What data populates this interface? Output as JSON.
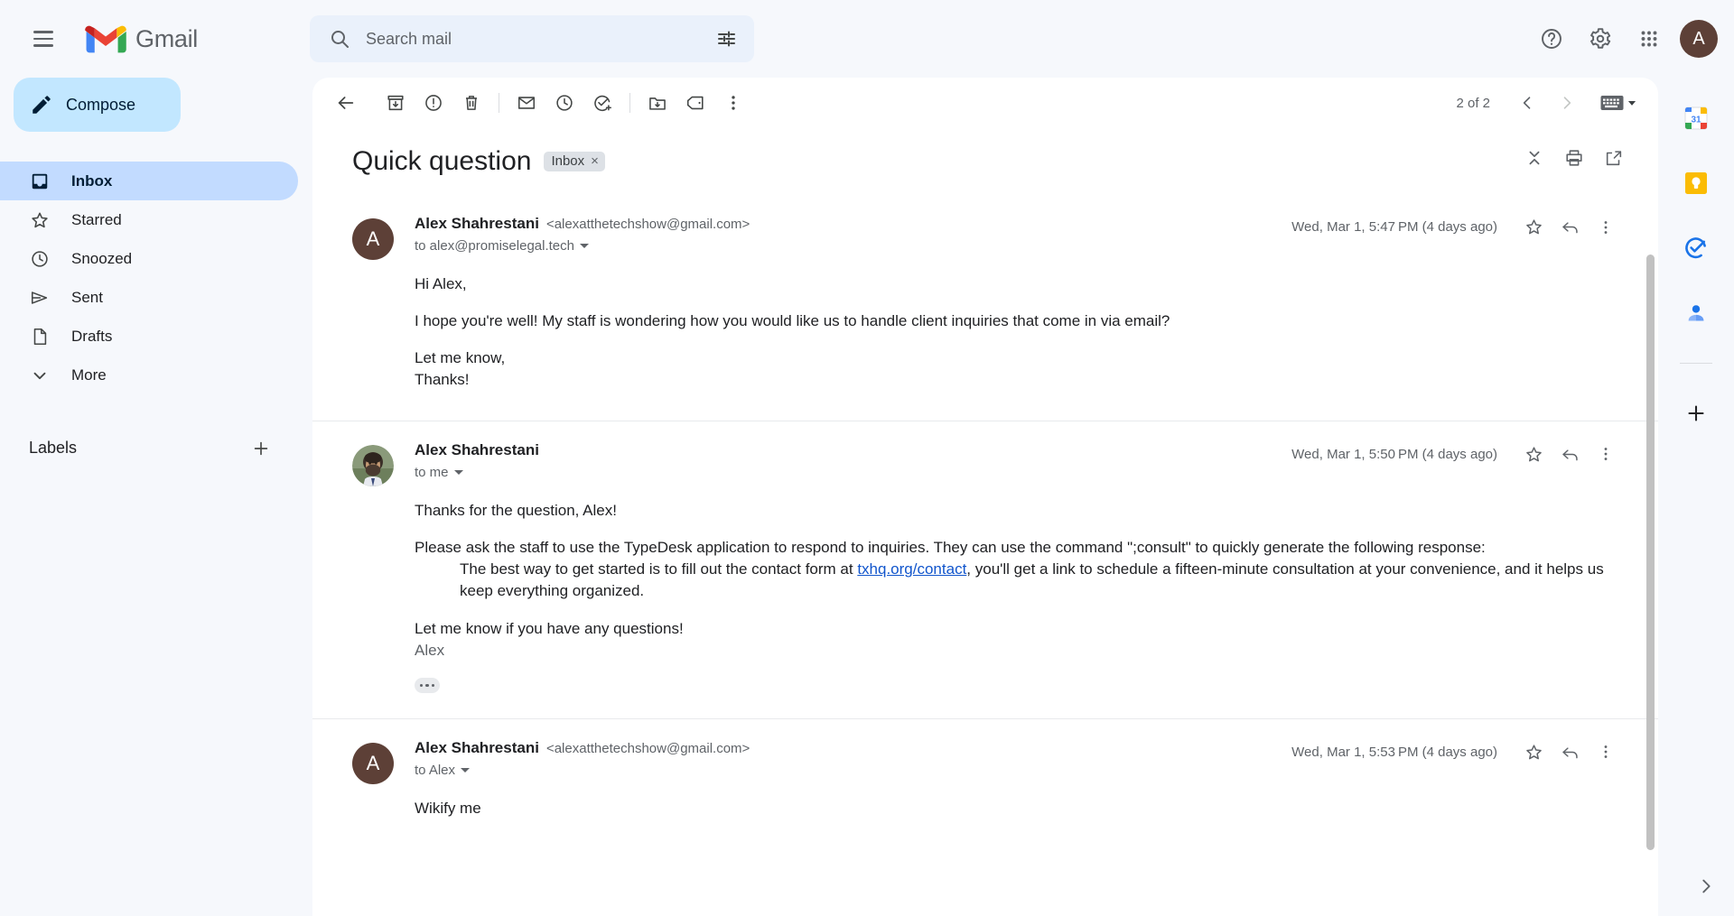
{
  "app": {
    "brand_name": "Gmail",
    "accent_blue": "#c2e7ff",
    "active_nav_bg": "#c2dbff",
    "avatar_color": "#5d4037",
    "link_color": "#1155cc"
  },
  "header": {
    "menu_icon": "hamburger-icon",
    "help_icon": "help-icon",
    "settings_icon": "gear-icon",
    "apps_icon": "apps-grid-icon",
    "account_initial": "A"
  },
  "search": {
    "placeholder": "Search mail",
    "value": "",
    "search_icon": "search-icon",
    "filter_icon": "filter-options-icon"
  },
  "sidebar": {
    "compose_label": "Compose",
    "compose_icon": "pencil-icon",
    "items": [
      {
        "label": "Inbox",
        "icon": "inbox-icon",
        "active": true
      },
      {
        "label": "Starred",
        "icon": "star-icon",
        "active": false
      },
      {
        "label": "Snoozed",
        "icon": "clock-icon",
        "active": false
      },
      {
        "label": "Sent",
        "icon": "send-icon",
        "active": false
      },
      {
        "label": "Drafts",
        "icon": "draft-icon",
        "active": false
      },
      {
        "label": "More",
        "icon": "chevron-down-icon",
        "active": false
      }
    ],
    "labels_title": "Labels",
    "labels_add_icon": "plus-icon"
  },
  "toolbar": {
    "back_icon": "back-arrow-icon",
    "archive_icon": "archive-icon",
    "spam_icon": "report-spam-icon",
    "delete_icon": "trash-icon",
    "mark_unread_icon": "mark-unread-icon",
    "snooze_icon": "snooze-clock-icon",
    "add_task_icon": "add-to-tasks-icon",
    "move_icon": "move-to-folder-icon",
    "label_icon": "label-tag-icon",
    "more_icon": "more-vertical-icon",
    "counter": "2 of 2",
    "prev_icon": "chevron-left-icon",
    "next_icon": "chevron-right-icon",
    "keyboard_icon": "keyboard-icon",
    "keyboard_caret_icon": "caret-down-icon"
  },
  "thread": {
    "subject": "Quick question",
    "label_chip": "Inbox",
    "label_chip_remove": "×",
    "collapse_icon": "collapse-all-icon",
    "print_icon": "print-icon",
    "popout_icon": "open-in-new-window-icon",
    "messages": [
      {
        "sender": "Alex Shahrestani",
        "email": "<alexatthetechshow@gmail.com>",
        "to": "to alex@promiselegal.tech",
        "date": "Wed, Mar 1, 5:47 PM (4 days ago)",
        "avatar_type": "initial",
        "avatar_initial": "A",
        "body": [
          "Hi Alex,",
          "I hope you're well! My staff is wondering how you would like us to handle client inquiries that come in via email?",
          "Let me know,",
          "Thanks!"
        ],
        "star_icon": "star-icon",
        "reply_icon": "reply-arrow-icon",
        "more_icon": "more-vertical-icon"
      },
      {
        "sender": "Alex Shahrestani",
        "email": "",
        "to": "to me",
        "date": "Wed, Mar 1, 5:50 PM (4 days ago)",
        "avatar_type": "photo",
        "avatar_initial": "",
        "body_p1": "Thanks for the question, Alex!",
        "body_p2": "Please ask the staff to use the TypeDesk application to respond to inquiries. They can use the command \";consult\" to quickly generate the following response:",
        "body_indent_pre": "The best way to get started is to fill out the contact form at ",
        "body_indent_link": "txhq.org/contact",
        "body_indent_post": ", you'll get a link to schedule a fifteen-minute consultation at your convenience, and it helps us keep everything organized.",
        "body_p3": "Let me know if you have any questions!",
        "signature": "Alex",
        "trimmed_icon": "show-trimmed-content-icon",
        "star_icon": "star-icon",
        "reply_icon": "reply-arrow-icon",
        "more_icon": "more-vertical-icon"
      },
      {
        "sender": "Alex Shahrestani",
        "email": "<alexatthetechshow@gmail.com>",
        "to": "to Alex",
        "date": "Wed, Mar 1, 5:53 PM (4 days ago)",
        "avatar_type": "initial",
        "avatar_initial": "A",
        "body": [
          "Wikify me"
        ],
        "star_icon": "star-icon",
        "reply_icon": "reply-arrow-icon",
        "more_icon": "more-vertical-icon"
      }
    ]
  },
  "rail": {
    "items": [
      {
        "icon": "google-calendar-icon"
      },
      {
        "icon": "google-keep-icon"
      },
      {
        "icon": "google-tasks-icon"
      },
      {
        "icon": "google-contacts-icon"
      }
    ],
    "add_icon": "plus-icon",
    "expand_icon": "chevron-right-icon"
  }
}
